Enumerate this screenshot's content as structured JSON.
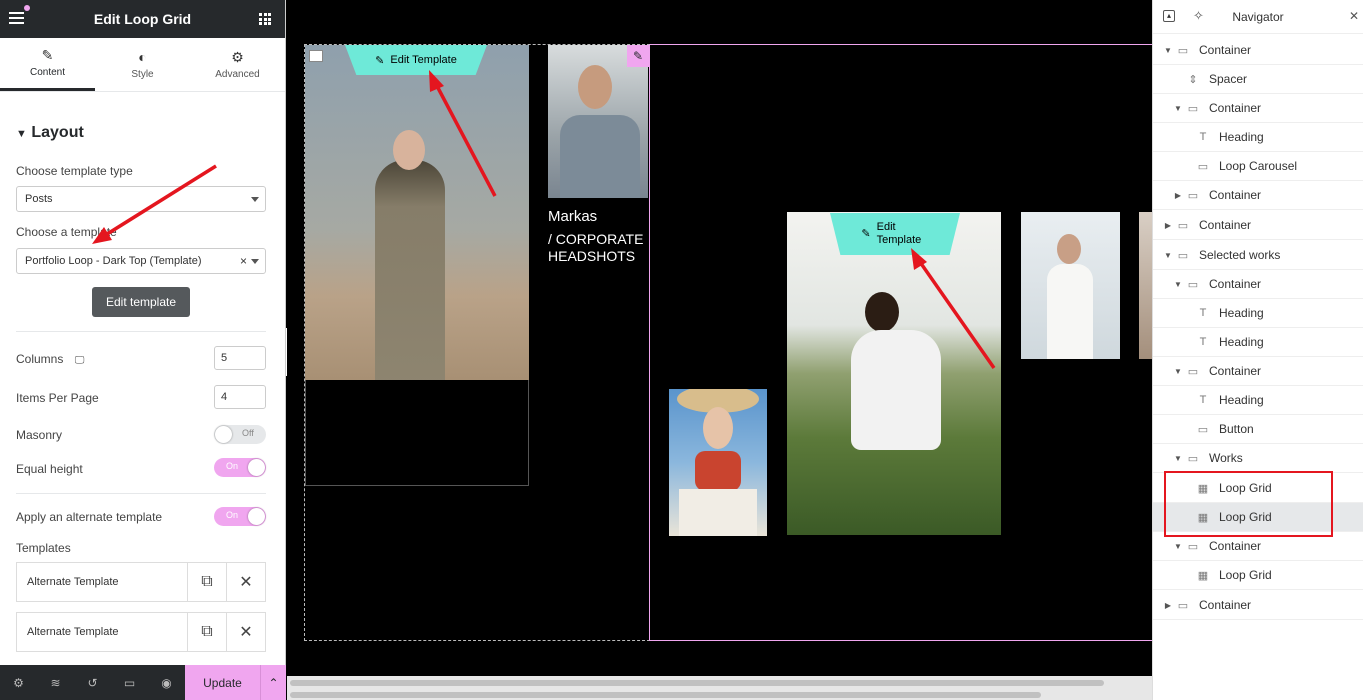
{
  "panel": {
    "title": "Edit Loop Grid",
    "tabs": [
      {
        "label": "Content",
        "icon": "pencil-icon"
      },
      {
        "label": "Style",
        "icon": "half-circle-icon"
      },
      {
        "label": "Advanced",
        "icon": "gear-icon"
      }
    ],
    "section": "Layout",
    "template_type_label": "Choose template type",
    "template_type_value": "Posts",
    "template_label": "Choose a template",
    "template_value": "Portfolio Loop - Dark Top (Template)",
    "edit_template_button": "Edit template",
    "columns_label": "Columns",
    "columns_value": "5",
    "items_per_page_label": "Items Per Page",
    "items_per_page_value": "4",
    "masonry_label": "Masonry",
    "masonry_state": "Off",
    "equal_height_label": "Equal height",
    "equal_height_state": "On",
    "alternate_label": "Apply an alternate template",
    "alternate_state": "On",
    "templates_label": "Templates",
    "templates": [
      "Alternate Template",
      "Alternate Template"
    ],
    "update_button": "Update"
  },
  "canvas": {
    "edit_template_1": "Edit Template",
    "edit_template_2": "Edit Template",
    "card_name": "Markas",
    "card_tag": "/ CORPORATE HEADSHOTS"
  },
  "navigator": {
    "title": "Navigator",
    "items": [
      {
        "label": "Container",
        "icon": "container-icon",
        "caret": "down"
      },
      {
        "label": "Spacer",
        "icon": "spacer-icon",
        "caret": ""
      },
      {
        "label": "Container",
        "icon": "container-icon",
        "caret": "down"
      },
      {
        "label": "Heading",
        "icon": "heading-icon",
        "caret": ""
      },
      {
        "label": "Loop Carousel",
        "icon": "carousel-icon",
        "caret": ""
      },
      {
        "label": "Container",
        "icon": "container-icon",
        "caret": "right"
      },
      {
        "label": "Container",
        "icon": "container-icon",
        "caret": "right"
      },
      {
        "label": "Selected works",
        "icon": "container-icon",
        "caret": "down"
      },
      {
        "label": "Container",
        "icon": "container-icon",
        "caret": "down"
      },
      {
        "label": "Heading",
        "icon": "heading-icon",
        "caret": ""
      },
      {
        "label": "Heading",
        "icon": "heading-icon",
        "caret": ""
      },
      {
        "label": "Container",
        "icon": "container-icon",
        "caret": "down"
      },
      {
        "label": "Heading",
        "icon": "heading-icon",
        "caret": ""
      },
      {
        "label": "Button",
        "icon": "button-icon",
        "caret": ""
      },
      {
        "label": "Works",
        "icon": "container-icon",
        "caret": "down"
      },
      {
        "label": "Loop Grid",
        "icon": "loop-grid-icon",
        "caret": ""
      },
      {
        "label": "Loop Grid",
        "icon": "loop-grid-icon",
        "caret": ""
      },
      {
        "label": "Container",
        "icon": "container-icon",
        "caret": "down"
      },
      {
        "label": "Loop Grid",
        "icon": "loop-grid-icon",
        "caret": ""
      },
      {
        "label": "Container",
        "icon": "container-icon",
        "caret": "right"
      }
    ]
  },
  "colors": {
    "accent": "#f0a6ef",
    "teal": "#6ee9d8",
    "dark": "#26292c",
    "annotation": "#e4161f"
  }
}
